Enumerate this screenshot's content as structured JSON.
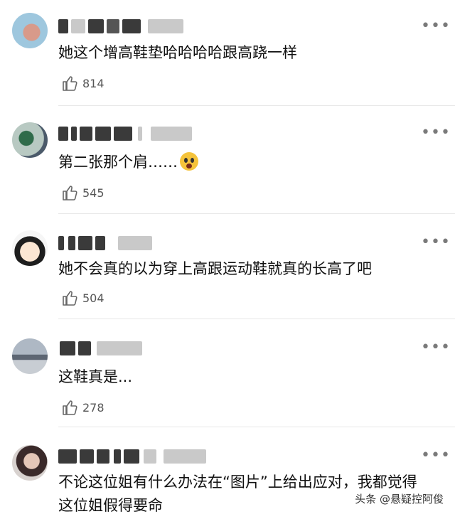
{
  "comments": [
    {
      "text": "她这个增高鞋垫哈哈哈哈跟高跷一样",
      "likes": "814"
    },
    {
      "text": "第二张那个肩……",
      "likes": "545"
    },
    {
      "text": "她不会真的以为穿上高跟运动鞋就真的长高了吧",
      "likes": "504"
    },
    {
      "text": "这鞋真是...",
      "likes": "278"
    },
    {
      "text": "不论这位姐有什么办法在“图片”上给出应对，我都觉得这位姐假得要命",
      "likes": ""
    }
  ],
  "more_glyph": "•••",
  "watermark": "头条 @悬疑控阿俊",
  "colors": {
    "text": "#111111",
    "meta": "#555555",
    "divider": "#e8e8e8",
    "accent_emoji": "#f5c33b"
  },
  "icons": {
    "like": "thumbs-up-outline-icon",
    "more": "more-dots-icon",
    "emoji": "fearful-face-emoji"
  }
}
